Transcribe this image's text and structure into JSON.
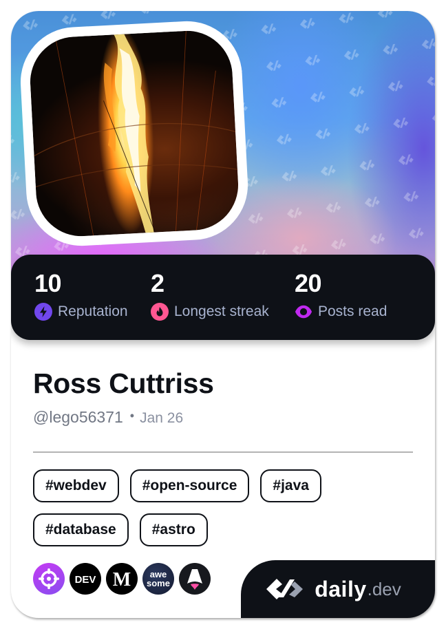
{
  "profile": {
    "name": "Ross Cuttriss",
    "handle": "@lego56371",
    "separator": "•",
    "joined": "Jan 26",
    "avatar_alt": "hot air balloon burner flame"
  },
  "stats": [
    {
      "value": "10",
      "label": "Reputation",
      "icon": "lightning-icon",
      "color": "#7147ed"
    },
    {
      "value": "2",
      "label": "Longest streak",
      "icon": "flame-icon",
      "color": "#ff5792"
    },
    {
      "value": "20",
      "label": "Posts read",
      "icon": "eye-ring-icon",
      "color": "#c029f0"
    }
  ],
  "tags": [
    "#webdev",
    "#open-source",
    "#java",
    "#database",
    "#astro"
  ],
  "sources": [
    {
      "name": "target-source",
      "icon": "crosshair-icon",
      "bg": "#a040f0"
    },
    {
      "name": "dev-to",
      "text": "DEV",
      "bg": "#000000"
    },
    {
      "name": "medium",
      "text": "M",
      "bg": "#000000"
    },
    {
      "name": "awesome",
      "text_top": "awe",
      "text_bottom": "some",
      "bg": "#1f2747"
    },
    {
      "name": "astro",
      "icon": "astro-rocket-icon",
      "bg": "#17191e"
    }
  ],
  "brand": {
    "name": "daily",
    "suffix": ".dev"
  }
}
